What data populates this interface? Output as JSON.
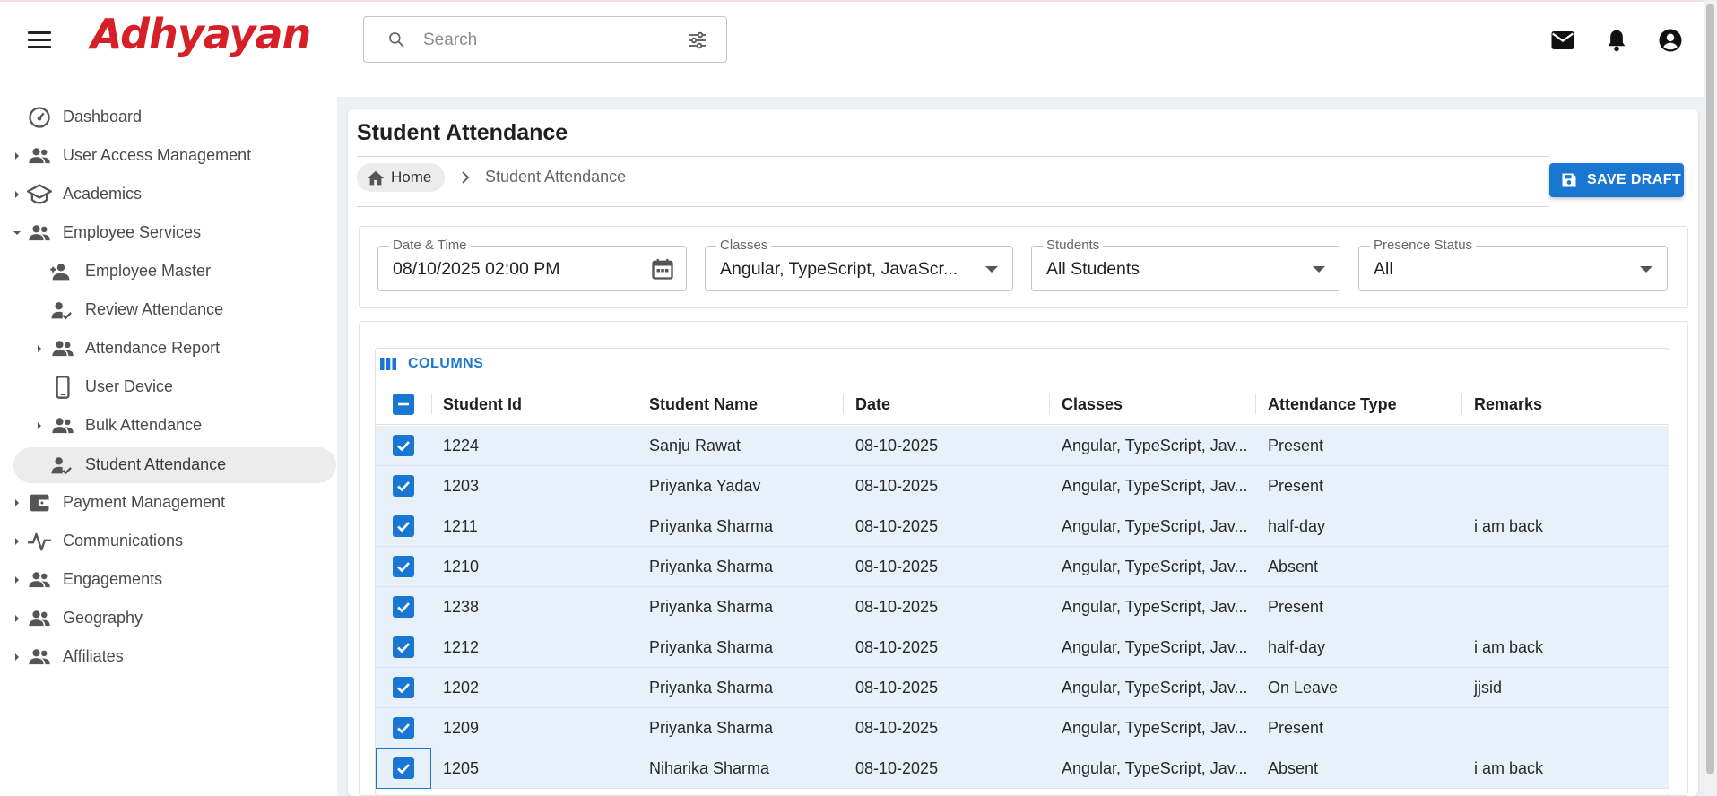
{
  "header": {
    "logo_text": "Adhyayan",
    "search_placeholder": "Search",
    "icons": [
      "menu-icon",
      "mail-icon",
      "bell-icon",
      "account-icon"
    ]
  },
  "sidebar": {
    "items": [
      {
        "label": "Dashboard",
        "icon": "dashboard-icon"
      },
      {
        "label": "User Access Management",
        "icon": "people-icon"
      },
      {
        "label": "Academics",
        "icon": "school-icon"
      },
      {
        "label": "Employee Services",
        "icon": "people-icon"
      },
      {
        "label": "Employee Master",
        "icon": "person-add-icon"
      },
      {
        "label": "Review Attendance",
        "icon": "person-check-icon"
      },
      {
        "label": "Attendance Report",
        "icon": "people-icon"
      },
      {
        "label": "User Device",
        "icon": "phone-icon"
      },
      {
        "label": "Bulk Attendance",
        "icon": "people-icon"
      },
      {
        "label": "Student Attendance",
        "icon": "person-check-icon"
      },
      {
        "label": "Payment Management",
        "icon": "wallet-icon"
      },
      {
        "label": "Communications",
        "icon": "pulse-icon"
      },
      {
        "label": "Engagements",
        "icon": "people-icon"
      },
      {
        "label": "Geography",
        "icon": "people-icon"
      },
      {
        "label": "Affiliates",
        "icon": "people-icon"
      }
    ]
  },
  "page": {
    "title": "Student Attendance",
    "breadcrumb_home": "Home",
    "breadcrumb_current": "Student Attendance",
    "save_label": "SAVE DRAFT"
  },
  "filters": {
    "datetime_label": "Date & Time",
    "datetime_value": "08/10/2025 02:00 PM",
    "classes_label": "Classes",
    "classes_value": "Angular, TypeScript, JavaScr...",
    "students_label": "Students",
    "students_value": "All Students",
    "presence_label": "Presence Status",
    "presence_value": "All"
  },
  "grid": {
    "columns_label": "COLUMNS",
    "headers": {
      "student_id": "Student Id",
      "student_name": "Student Name",
      "date": "Date",
      "classes": "Classes",
      "attendance_type": "Attendance Type",
      "remarks": "Remarks"
    },
    "rows": [
      {
        "id": "1224",
        "name": "Sanju Rawat",
        "date": "08-10-2025",
        "classes": "Angular, TypeScript, Jav...",
        "type": "Present",
        "remarks": ""
      },
      {
        "id": "1203",
        "name": "Priyanka Yadav",
        "date": "08-10-2025",
        "classes": "Angular, TypeScript, Jav...",
        "type": "Present",
        "remarks": ""
      },
      {
        "id": "1211",
        "name": "Priyanka Sharma",
        "date": "08-10-2025",
        "classes": "Angular, TypeScript, Jav...",
        "type": "half-day",
        "remarks": "i am back"
      },
      {
        "id": "1210",
        "name": "Priyanka Sharma",
        "date": "08-10-2025",
        "classes": "Angular, TypeScript, Jav...",
        "type": "Absent",
        "remarks": ""
      },
      {
        "id": "1238",
        "name": "Priyanka Sharma",
        "date": "08-10-2025",
        "classes": "Angular, TypeScript, Jav...",
        "type": "Present",
        "remarks": ""
      },
      {
        "id": "1212",
        "name": "Priyanka Sharma",
        "date": "08-10-2025",
        "classes": "Angular, TypeScript, Jav...",
        "type": "half-day",
        "remarks": "i am back"
      },
      {
        "id": "1202",
        "name": "Priyanka Sharma",
        "date": "08-10-2025",
        "classes": "Angular, TypeScript, Jav...",
        "type": "On Leave",
        "remarks": "jjsid"
      },
      {
        "id": "1209",
        "name": "Priyanka Sharma",
        "date": "08-10-2025",
        "classes": "Angular, TypeScript, Jav...",
        "type": "Present",
        "remarks": ""
      },
      {
        "id": "1205",
        "name": "Niharika Sharma",
        "date": "08-10-2025",
        "classes": "Angular, TypeScript, Jav...",
        "type": "Absent",
        "remarks": "i am back"
      }
    ]
  },
  "colors": {
    "brand_red": "#d61f26",
    "primary_blue": "#1976d2",
    "selected_row": "#e8f0fa"
  }
}
